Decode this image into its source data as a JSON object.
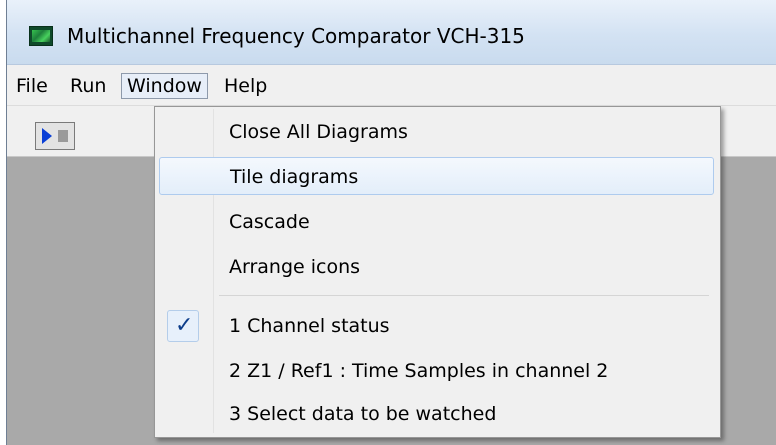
{
  "window": {
    "title": "Multichannel Frequency Comparator VCH-315",
    "icon": "app-icon"
  },
  "menubar": {
    "items": [
      "File",
      "Run",
      "Window",
      "Help"
    ],
    "active": "Window"
  },
  "toolbar": {
    "buttons": [
      {
        "icon": "play-icon"
      },
      {
        "icon": "stop-icon"
      }
    ]
  },
  "window_menu": {
    "items": [
      {
        "label": "Close All Diagrams"
      },
      {
        "label": "Tile diagrams",
        "highlighted": true
      },
      {
        "label": "Cascade"
      },
      {
        "label": "Arrange icons"
      },
      {
        "label": "1 Channel status",
        "checked": true
      },
      {
        "label": "2 Z1 / Ref1 : Time Samples in channel 2"
      },
      {
        "label": "3 Select data to be watched"
      }
    ],
    "check_glyph": "✓"
  },
  "colors": {
    "workspace": "#a9a9a9",
    "menu_bg": "#f0f0f0",
    "highlight_border": "#aecbee",
    "play": "#0a3fd6"
  }
}
